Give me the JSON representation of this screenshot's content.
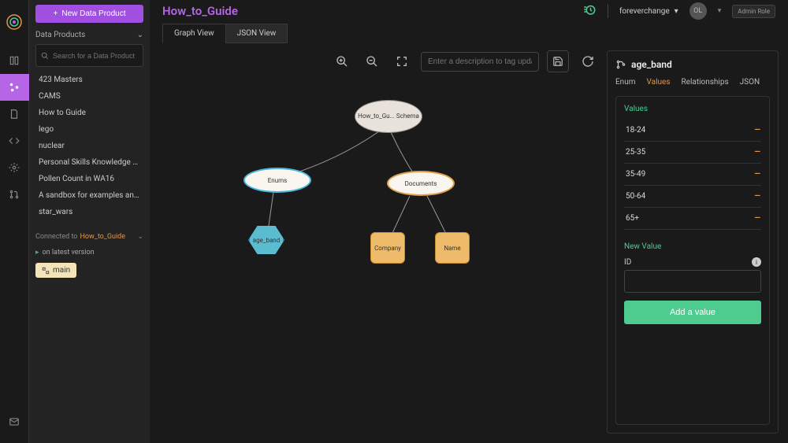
{
  "header": {
    "title": "How_to_Guide",
    "user": "foreverchange",
    "avatar": "OL",
    "admin_role": "Admin Role"
  },
  "new_product_btn": "New Data Product",
  "sidebar": {
    "section": "Data Products",
    "search_placeholder": "Search for a Data Product",
    "items": [
      "423 Masters",
      "CAMS",
      "How to Guide",
      "lego",
      "nuclear",
      "Personal Skills Knowledge Gr...",
      "Pollen Count in WA16",
      "A sandbox for examples and r...",
      "star_wars"
    ],
    "connected_prefix": "Connected to",
    "connected_target": "How_to_Guide",
    "version_text": "on latest version",
    "branch": "main"
  },
  "tabs": {
    "graph": "Graph View",
    "json": "JSON View"
  },
  "graph_toolbar": {
    "desc_placeholder": "Enter a description to tag update"
  },
  "graph": {
    "root": "How_to_Gu... Schema",
    "enums": "Enums",
    "documents": "Documents",
    "age_band": "age_band",
    "company": "Company",
    "name": "Name"
  },
  "detail": {
    "title": "age_band",
    "tabs": {
      "enum": "Enum",
      "values": "Values",
      "relationships": "Relationships",
      "json": "JSON"
    },
    "values_title": "Values",
    "values": [
      "18-24",
      "25-35",
      "35-49",
      "50-64",
      "65+"
    ],
    "new_value_title": "New Value",
    "id_label": "ID",
    "add_btn": "Add a value"
  }
}
